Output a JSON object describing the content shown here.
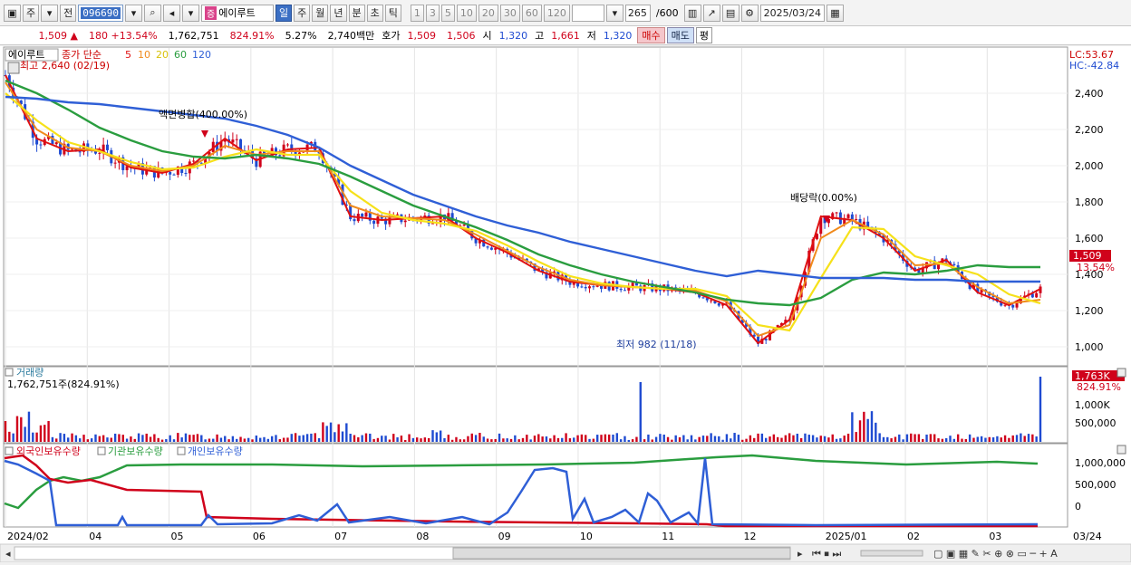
{
  "toolbar": {
    "type_label": "주",
    "prev_label": "전",
    "code": "096690",
    "stock_badge": "증",
    "stock_name": "에이루트",
    "period_tabs": [
      "일",
      "주",
      "월",
      "년",
      "분",
      "초",
      "틱"
    ],
    "interval_tabs": [
      "1",
      "3",
      "5",
      "10",
      "20",
      "30",
      "60",
      "120"
    ],
    "count_display": "265",
    "count_max": "/600",
    "date": "2025/03/24"
  },
  "quote": {
    "price": "1,509",
    "change": "180",
    "change_pct": "+13.54%",
    "volume": "1,762,751",
    "volume_ratio": "824.91%",
    "turnover": "5.27%",
    "amount": "2,740백만",
    "hoga_label": "호가",
    "ask": "1,509",
    "bid": "1,506",
    "open_label": "시",
    "open": "1,320",
    "high_label": "고",
    "high": "1,661",
    "low_label": "저",
    "low": "1,320",
    "buy_label": "매수",
    "sell_label": "매도",
    "flat_label": "평"
  },
  "panels": {
    "price_title": "에이루트",
    "ma_label": "종가 단순",
    "ma_periods": [
      "5",
      "10",
      "20",
      "60",
      "120"
    ],
    "high_note": "최고 2,640 (02/19)",
    "low_note": "최저 982 (11/18)",
    "split_note": "액면병합(400.00%)",
    "dividend_note": "배당락(0.00%)",
    "lc": "LC:53.67",
    "hc": "HC:-42.84",
    "last_price": "1,509",
    "last_pct": "13.54%",
    "volume_title": "거래량",
    "volume_note": "1,762,751주(824.91%)",
    "vol_last": "1,763K",
    "vol_last_pct": "824.91%",
    "holdings": [
      "외국인보유수량",
      "기관보유수량",
      "개인보유수량"
    ]
  },
  "colors": {
    "up": "#d0021b",
    "down": "#1f4bd1",
    "ma5": "#e01010",
    "ma10": "#f08a1c",
    "ma20": "#f6e11a",
    "ma60": "#2a9d3f",
    "ma120": "#2f5fd6"
  },
  "chart_data": {
    "type": "line",
    "x_ticks": [
      "2024/02",
      "04",
      "05",
      "06",
      "07",
      "08",
      "09",
      "10",
      "11",
      "12",
      "2025/01",
      "02",
      "03",
      "03/24"
    ],
    "price_axis": [
      "2,400",
      "2,200",
      "2,000",
      "1,800",
      "1,600",
      "1,400",
      "1,200",
      "1,000"
    ],
    "volume_axis": [
      "1,000K",
      "500,000"
    ],
    "holding_axis": [
      "1,000,000",
      "500,000",
      "0"
    ],
    "ylim": [
      900,
      2650
    ],
    "series": [
      {
        "name": "5",
        "values": [
          2500,
          2150,
          2080,
          2090,
          1990,
          1960,
          2010,
          2150,
          2030,
          2090,
          2100,
          1720,
          1700,
          1710,
          1720,
          1600,
          1520,
          1420,
          1360,
          1340,
          1330,
          1320,
          1300,
          1230,
          1020,
          1150,
          1720,
          1700,
          1600,
          1420,
          1480,
          1300,
          1230,
          1320
        ]
      },
      {
        "name": "10",
        "values": [
          2460,
          2200,
          2100,
          2080,
          2000,
          1970,
          2000,
          2110,
          2060,
          2080,
          2080,
          1780,
          1720,
          1710,
          1700,
          1620,
          1530,
          1440,
          1370,
          1340,
          1330,
          1320,
          1310,
          1250,
          1060,
          1120,
          1600,
          1700,
          1620,
          1450,
          1460,
          1330,
          1240,
          1260
        ]
      },
      {
        "name": "20",
        "values": [
          2400,
          2250,
          2130,
          2080,
          2020,
          1980,
          1990,
          2050,
          2090,
          2060,
          2060,
          1860,
          1740,
          1700,
          1680,
          1640,
          1560,
          1470,
          1390,
          1350,
          1330,
          1320,
          1320,
          1280,
          1120,
          1090,
          1380,
          1660,
          1650,
          1500,
          1450,
          1400,
          1290,
          1240
        ]
      },
      {
        "name": "60",
        "values": [
          2470,
          2400,
          2310,
          2210,
          2140,
          2080,
          2050,
          2040,
          2060,
          2040,
          2010,
          1940,
          1860,
          1780,
          1720,
          1660,
          1590,
          1510,
          1450,
          1400,
          1360,
          1330,
          1300,
          1260,
          1240,
          1230,
          1270,
          1370,
          1410,
          1400,
          1420,
          1450,
          1440,
          1440
        ]
      },
      {
        "name": "120",
        "values": [
          2380,
          2370,
          2350,
          2340,
          2320,
          2300,
          2280,
          2260,
          2220,
          2170,
          2100,
          2000,
          1920,
          1840,
          1780,
          1720,
          1670,
          1630,
          1580,
          1540,
          1500,
          1460,
          1420,
          1390,
          1420,
          1400,
          1380,
          1380,
          1380,
          1370,
          1370,
          1360,
          1360,
          1360
        ]
      }
    ]
  }
}
